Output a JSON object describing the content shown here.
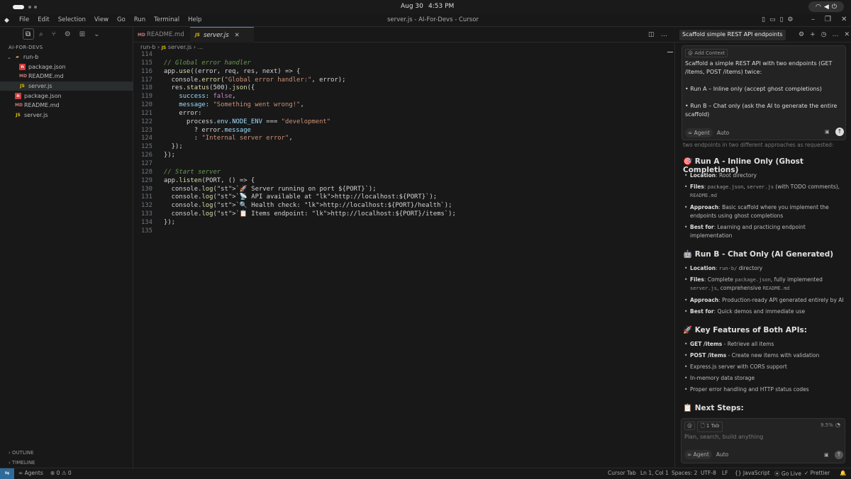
{
  "topbar": {
    "date": "Aug 30",
    "time": "4:53 PM"
  },
  "menubar": {
    "menus": [
      "File",
      "Edit",
      "Selection",
      "View",
      "Go",
      "Run",
      "Terminal",
      "Help"
    ],
    "title": "server.js - AI-For-Devs - Cursor"
  },
  "sidebar": {
    "title": "AI-FOR-DEVS",
    "tree": [
      {
        "label": "run-b",
        "type": "folder",
        "indent": 1
      },
      {
        "label": "package.json",
        "type": "json",
        "indent": 2
      },
      {
        "label": "README.md",
        "type": "md",
        "indent": 2
      },
      {
        "label": "server.js",
        "type": "js",
        "indent": 2,
        "selected": true
      },
      {
        "label": "package.json",
        "type": "json",
        "indent": 1
      },
      {
        "label": "README.md",
        "type": "md",
        "indent": 1
      },
      {
        "label": "server.js",
        "type": "js",
        "indent": 1
      }
    ],
    "outline": "OUTLINE",
    "timeline": "TIMELINE"
  },
  "editor": {
    "tabs": [
      "README.md",
      "server.js"
    ],
    "breadcrumb": [
      "run-b",
      "server.js",
      "..."
    ],
    "lines": [
      {
        "n": "114",
        "code": ""
      },
      {
        "n": "115",
        "code": "// Global error handler"
      },
      {
        "n": "116",
        "code": "app.use((error, req, res, next) => {"
      },
      {
        "n": "117",
        "code": "  console.error(\"Global error handler:\", error);"
      },
      {
        "n": "118",
        "code": "  res.status(500).json({"
      },
      {
        "n": "119",
        "code": "    success: false,"
      },
      {
        "n": "120",
        "code": "    message: \"Something went wrong!\","
      },
      {
        "n": "121",
        "code": "    error:"
      },
      {
        "n": "122",
        "code": "      process.env.NODE_ENV === \"development\""
      },
      {
        "n": "123",
        "code": "        ? error.message"
      },
      {
        "n": "124",
        "code": "        : \"Internal server error\","
      },
      {
        "n": "125",
        "code": "  });"
      },
      {
        "n": "126",
        "code": "});"
      },
      {
        "n": "127",
        "code": ""
      },
      {
        "n": "128",
        "code": "// Start server"
      },
      {
        "n": "129",
        "code": "app.listen(PORT, () => {"
      },
      {
        "n": "130",
        "code": "  console.log(`🚀 Server running on port ${PORT}`);"
      },
      {
        "n": "131",
        "code": "  console.log(`📡 API available at http://localhost:${PORT}`);"
      },
      {
        "n": "132",
        "code": "  console.log(`🔍 Health check: http://localhost:${PORT}/health`);"
      },
      {
        "n": "133",
        "code": "  console.log(`📋 Items endpoint: http://localhost:${PORT}/items`);"
      },
      {
        "n": "134",
        "code": "});"
      },
      {
        "n": "135",
        "code": ""
      }
    ]
  },
  "chat": {
    "tab_title": "Scaffold simple REST API endpoints",
    "add_context": "@ Add Context",
    "prompt_lines": [
      "Scaffold a simple REST API with two endpoints (GET /items, POST /items) twice:",
      "• Run A – Inline only (accept ghost completions)",
      "• Run B – Chat only (ask the AI to generate the entire scaffold)"
    ],
    "agent_label": "∞ Agent",
    "auto_label": "Auto",
    "faded_text": "two endpoints in two different approaches as requested:",
    "sections": [
      {
        "heading": "🎯 Run A - Inline Only (Ghost Completions)"
      },
      {
        "heading": "🤖 Run B - Chat Only (AI Generated)"
      },
      {
        "heading": "🚀 Key Features of Both APIs:"
      },
      {
        "heading": "📋 Next Steps:"
      }
    ],
    "runA": {
      "location_label": "Location",
      "location_value": ": Root directory",
      "files_label": "Files",
      "files_mid": " (with TODO comments), ",
      "files_code1": "package.json",
      "files_code2": "server.js",
      "files_code3": "README.md",
      "approach_label": "Approach",
      "approach_value": ": Basic scaffold where you implement the endpoints using ghost completions",
      "best_label": "Best for",
      "best_value": ": Learning and practicing endpoint implementation"
    },
    "runB": {
      "location_label": "Location",
      "location_code": "run-b/",
      "location_value": " directory",
      "files_label": "Files",
      "files_pre": ": Complete ",
      "files_code1": "package.json",
      "files_mid": ", fully implemented ",
      "files_code2": "server.js",
      "files_mid2": ", comprehensive ",
      "files_code3": "README.md",
      "approach_label": "Approach",
      "approach_value": ": Production-ready API generated entirely by AI",
      "best_label": "Best for",
      "best_value": ": Quick demos and immediate use"
    },
    "features": [
      {
        "b": "GET /items",
        "t": " - Retrieve all items"
      },
      {
        "b": "POST /items",
        "t": " - Create new items with validation"
      },
      {
        "b": "",
        "t": "Express.js server with CORS support"
      },
      {
        "b": "",
        "t": "In-memory data storage"
      },
      {
        "b": "",
        "t": "Proper error handling and HTTP status codes"
      }
    ],
    "bottom": {
      "at": "@",
      "tab_chip": "1 Tab",
      "percent": "9.5%",
      "placeholder": "Plan, search, build anything",
      "agent_label": "∞ Agent",
      "auto_label": "Auto"
    }
  },
  "status": {
    "agents": "∞ Agents",
    "problems": "⊗ 0 ⚠ 0",
    "cursor_tab": "Cursor Tab",
    "position": "Ln 1, Col 1",
    "spaces": "Spaces: 2",
    "encoding": "UTF-8",
    "eol": "LF",
    "language": "{} JavaScript",
    "golive": "Go Live",
    "prettier": "✓ Prettier"
  },
  "colors": {
    "accent": "#4a90e2",
    "remote": "#2f6b9a",
    "background": "#181818"
  }
}
